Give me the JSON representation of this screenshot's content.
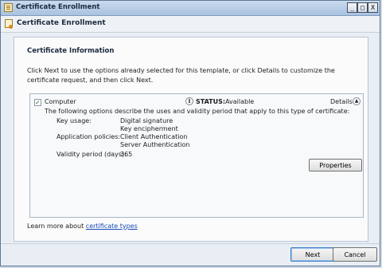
{
  "window": {
    "title": "Certificate Enrollment",
    "controls": {
      "minimize": "_",
      "maximize": "□",
      "close": "X"
    }
  },
  "header": {
    "title": "Certificate Enrollment"
  },
  "content": {
    "section_title": "Certificate Information",
    "intro": "Click Next to use the options already selected for this template, or click Details to customize the certificate request, and then click Next.",
    "panel": {
      "checkbox_checked": true,
      "checkbox_label": "Computer",
      "status_label": "STATUS:",
      "status_value": "Available",
      "details_label": "Details",
      "description": "The following options describe the uses and validity period that apply to this type of certificate:",
      "key_usage_label": "Key usage:",
      "key_usage_values": [
        "Digital signature",
        "Key encipherment"
      ],
      "application_policies_label": "Application policies:",
      "application_policies_values": [
        "Client Authentication",
        "Server Authentication"
      ],
      "validity_label": "Validity period (days):",
      "validity_value": "365",
      "properties_button": "Properties"
    },
    "learn_more_text": "Learn more about",
    "learn_more_link": "certificate types"
  },
  "footer": {
    "next_label": "Next",
    "cancel_label": "Cancel"
  },
  "icons": {
    "app": "certificate-icon",
    "info": "info-icon",
    "details": "chevron-up-icon"
  }
}
